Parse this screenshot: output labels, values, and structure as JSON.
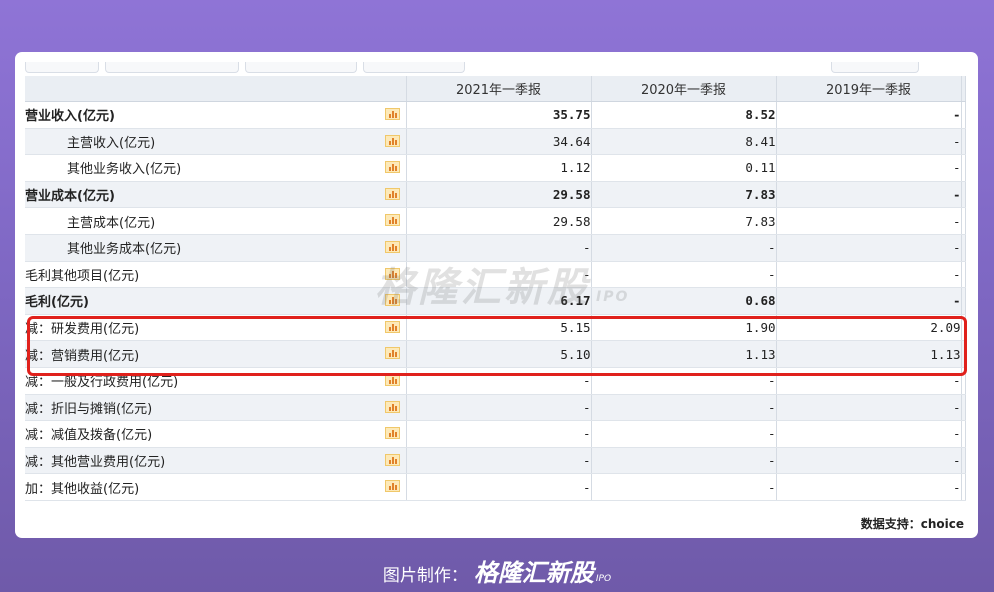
{
  "table": {
    "columns": [
      "2021年一季报",
      "2020年一季报",
      "2019年一季报"
    ],
    "rows": [
      {
        "label": "营业收入(亿元)",
        "values": [
          "35.75",
          "8.52",
          "-"
        ],
        "bold": true,
        "indent": false
      },
      {
        "label": "主营收入(亿元)",
        "values": [
          "34.64",
          "8.41",
          "-"
        ],
        "bold": false,
        "indent": true
      },
      {
        "label": "其他业务收入(亿元)",
        "values": [
          "1.12",
          "0.11",
          "-"
        ],
        "bold": false,
        "indent": true
      },
      {
        "label": "营业成本(亿元)",
        "values": [
          "29.58",
          "7.83",
          "-"
        ],
        "bold": true,
        "indent": false
      },
      {
        "label": "主营成本(亿元)",
        "values": [
          "29.58",
          "7.83",
          "-"
        ],
        "bold": false,
        "indent": true
      },
      {
        "label": "其他业务成本(亿元)",
        "values": [
          "-",
          "-",
          "-"
        ],
        "bold": false,
        "indent": true
      },
      {
        "label": "毛利其他项目(亿元)",
        "values": [
          "-",
          "-",
          "-"
        ],
        "bold": false,
        "indent": false
      },
      {
        "label": "毛利(亿元)",
        "values": [
          "6.17",
          "0.68",
          "-"
        ],
        "bold": true,
        "indent": false
      },
      {
        "label": "减：研发费用(亿元)",
        "values": [
          "5.15",
          "1.90",
          "2.09"
        ],
        "bold": false,
        "indent": false
      },
      {
        "label": "减：营销费用(亿元)",
        "values": [
          "5.10",
          "1.13",
          "1.13"
        ],
        "bold": false,
        "indent": false
      },
      {
        "label": "减：一般及行政费用(亿元)",
        "values": [
          "-",
          "-",
          "-"
        ],
        "bold": false,
        "indent": false
      },
      {
        "label": "减：折旧与摊销(亿元)",
        "values": [
          "-",
          "-",
          "-"
        ],
        "bold": false,
        "indent": false
      },
      {
        "label": "减：减值及拨备(亿元)",
        "values": [
          "-",
          "-",
          "-"
        ],
        "bold": false,
        "indent": false
      },
      {
        "label": "减：其他营业费用(亿元)",
        "values": [
          "-",
          "-",
          "-"
        ],
        "bold": false,
        "indent": false
      },
      {
        "label": "加：其他收益(亿元)",
        "values": [
          "-",
          "-",
          "-"
        ],
        "bold": false,
        "indent": false
      }
    ]
  },
  "watermark": {
    "text": "格隆汇新股",
    "sub": "IPO"
  },
  "source_note": "数据支持：choice",
  "footer": {
    "prefix": "图片制作：",
    "brand": "格隆汇新股",
    "brand_sub": "IPO"
  },
  "colors": {
    "highlight": "#e0211c",
    "background": "#8f74d6",
    "row_alt": "#eff2f6",
    "header": "#eaeef3"
  },
  "icons": {
    "row_chart": "bar-chart-icon"
  }
}
